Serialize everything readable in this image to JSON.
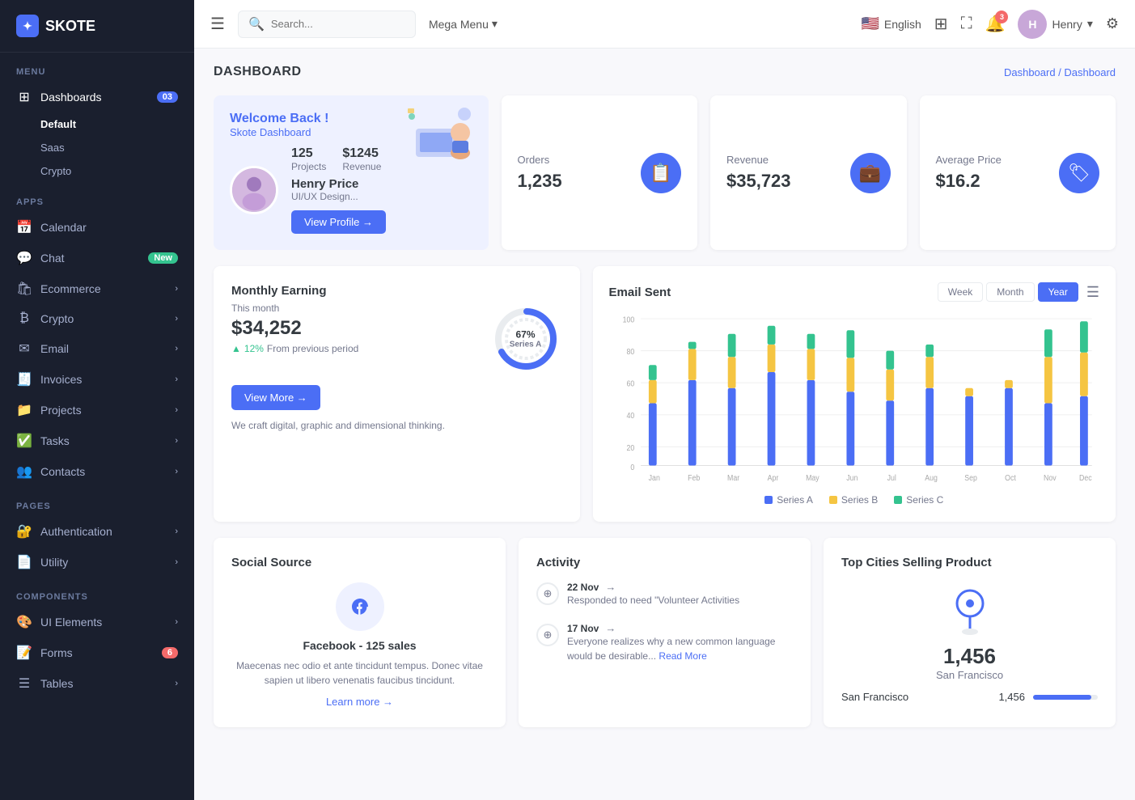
{
  "sidebar": {
    "logo": "SKOTE",
    "sections": [
      {
        "label": "MENU",
        "items": [
          {
            "id": "dashboards",
            "icon": "⊞",
            "label": "Dashboards",
            "badge": "03",
            "badge_type": "blue",
            "expanded": true,
            "subitems": [
              {
                "id": "default",
                "label": "Default",
                "active": true
              },
              {
                "id": "saas",
                "label": "Saas"
              },
              {
                "id": "crypto",
                "label": "Crypto"
              }
            ]
          }
        ]
      },
      {
        "label": "APPS",
        "items": [
          {
            "id": "calendar",
            "icon": "📅",
            "label": "Calendar"
          },
          {
            "id": "chat",
            "icon": "💬",
            "label": "Chat",
            "badge": "New",
            "badge_type": "green"
          },
          {
            "id": "ecommerce",
            "icon": "🛍",
            "label": "Ecommerce",
            "has_chevron": true
          },
          {
            "id": "crypto",
            "icon": "₿",
            "label": "Crypto",
            "has_chevron": true
          },
          {
            "id": "email",
            "icon": "✉",
            "label": "Email",
            "has_chevron": true
          },
          {
            "id": "invoices",
            "icon": "🧾",
            "label": "Invoices",
            "has_chevron": true
          },
          {
            "id": "projects",
            "icon": "📁",
            "label": "Projects",
            "has_chevron": true
          },
          {
            "id": "tasks",
            "icon": "✅",
            "label": "Tasks",
            "has_chevron": true
          },
          {
            "id": "contacts",
            "icon": "👥",
            "label": "Contacts",
            "has_chevron": true
          }
        ]
      },
      {
        "label": "PAGES",
        "items": [
          {
            "id": "authentication",
            "icon": "🔐",
            "label": "Authentication",
            "has_chevron": true
          },
          {
            "id": "utility",
            "icon": "📄",
            "label": "Utility",
            "has_chevron": true
          }
        ]
      },
      {
        "label": "COMPONENTS",
        "items": [
          {
            "id": "ui-elements",
            "icon": "🎨",
            "label": "UI Elements",
            "has_chevron": true
          },
          {
            "id": "forms",
            "icon": "📝",
            "label": "Forms",
            "badge": "6",
            "badge_type": "red"
          },
          {
            "id": "tables",
            "icon": "☰",
            "label": "Tables",
            "has_chevron": true
          }
        ]
      }
    ]
  },
  "topbar": {
    "hamburger_label": "☰",
    "search_placeholder": "Search...",
    "mega_menu_label": "Mega Menu",
    "language": "English",
    "notification_count": "3",
    "user_name": "Henry",
    "grid_icon": "⊞",
    "fullscreen_icon": "⛶"
  },
  "page": {
    "title": "DASHBOARD",
    "breadcrumb": "Dashboard / Dashboard"
  },
  "welcome_card": {
    "title": "Welcome Back !",
    "subtitle": "Skote Dashboard",
    "projects_count": "125",
    "projects_label": "Projects",
    "revenue_amount": "$1245",
    "revenue_label": "Revenue",
    "user_name": "Henry Price",
    "user_role": "UI/UX Design...",
    "view_profile_btn": "View Profile →"
  },
  "stats": [
    {
      "id": "orders",
      "label": "Orders",
      "value": "1,235",
      "icon": "📋",
      "icon_color": "#4b6ef5"
    },
    {
      "id": "revenue",
      "label": "Revenue",
      "value": "$35,723",
      "icon": "💼",
      "icon_color": "#4b6ef5"
    },
    {
      "id": "avg-price",
      "label": "Average Price",
      "value": "$16.2",
      "icon": "🏷",
      "icon_color": "#4b6ef5"
    }
  ],
  "monthly_earning": {
    "title": "Monthly Earning",
    "period": "This month",
    "amount": "$34,252",
    "change_pct": "12%",
    "change_text": "From previous period",
    "donut_pct": "67%",
    "donut_label": "Series A",
    "view_more_btn": "View More →",
    "footer": "We craft digital, graphic and dimensional thinking."
  },
  "email_chart": {
    "title": "Email Sent",
    "periods": [
      "Week",
      "Month",
      "Year"
    ],
    "active_period": "Year",
    "y_labels": [
      "100",
      "80",
      "60",
      "40",
      "20",
      "0"
    ],
    "x_labels": [
      "Jan",
      "Feb",
      "Mar",
      "Apr",
      "May",
      "Jun",
      "Jul",
      "Aug",
      "Sep",
      "Oct",
      "Nov",
      "Dec"
    ],
    "series": [
      {
        "name": "Series A",
        "color": "#4b6ef5"
      },
      {
        "name": "Series B",
        "color": "#f5c542"
      },
      {
        "name": "Series C",
        "color": "#34c38f"
      }
    ],
    "bar_data": [
      {
        "a": 40,
        "b": 15,
        "c": 10
      },
      {
        "a": 55,
        "b": 20,
        "c": 5
      },
      {
        "a": 50,
        "b": 20,
        "c": 15
      },
      {
        "a": 60,
        "b": 18,
        "c": 12
      },
      {
        "a": 55,
        "b": 20,
        "c": 10
      },
      {
        "a": 48,
        "b": 22,
        "c": 18
      },
      {
        "a": 42,
        "b": 20,
        "c": 12
      },
      {
        "a": 50,
        "b": 20,
        "c": 8
      },
      {
        "a": 45,
        "b": 5,
        "c": 0
      },
      {
        "a": 50,
        "b": 5,
        "c": 0
      },
      {
        "a": 40,
        "b": 30,
        "c": 18
      },
      {
        "a": 45,
        "b": 28,
        "c": 20
      }
    ]
  },
  "social_source": {
    "title": "Social Source",
    "platform": "Facebook",
    "sales_count": "125 sales",
    "description": "Maecenas nec odio et ante tincidunt tempus. Donec vitae sapien ut libero venenatis faucibus tincidunt.",
    "learn_more": "Learn more →"
  },
  "activity": {
    "title": "Activity",
    "items": [
      {
        "date": "22 Nov",
        "text": "Responded to need \"Volunteer Activities"
      },
      {
        "date": "17 Nov",
        "text": "Everyone realizes why a new common language would be desirable...",
        "read_more": "Read More"
      }
    ]
  },
  "top_cities": {
    "title": "Top Cities Selling Product",
    "top_count": "1,456",
    "top_city": "San Francisco",
    "rows": [
      {
        "city": "San Francisco",
        "count": "1,456",
        "pct": 90
      }
    ]
  }
}
